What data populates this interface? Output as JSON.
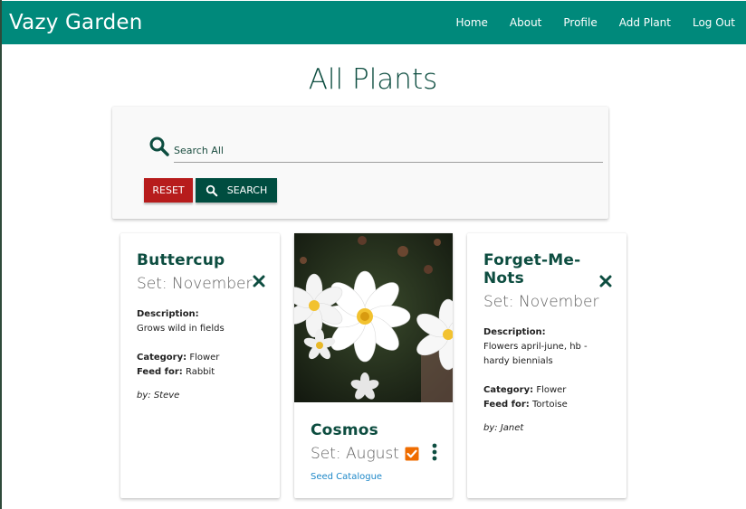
{
  "app": {
    "brand": "Vazy Garden"
  },
  "nav": {
    "items": [
      {
        "label": "Home"
      },
      {
        "label": "About"
      },
      {
        "label": "Profile"
      },
      {
        "label": "Add Plant"
      },
      {
        "label": "Log Out"
      }
    ]
  },
  "page": {
    "title": "All Plants"
  },
  "search": {
    "placeholder": "Search All",
    "value": "",
    "reset_label": "RESET",
    "search_label": "SEARCH"
  },
  "colors": {
    "navbar": "#00897b",
    "title": "#0d4d40",
    "reset": "#b71c1c",
    "search_button": "#004d40",
    "check": "#ef6c00",
    "link": "#1e88c8"
  },
  "cards": [
    {
      "name": "Buttercup",
      "set": "Set: November",
      "description_label": "Description:",
      "description": "Grows wild in fields",
      "category_label": "Category:",
      "category": "Flower",
      "feed_label": "Feed for:",
      "feed": "Rabbit",
      "author": "by: Steve",
      "action_icon": "close-icon"
    },
    {
      "name": "Cosmos",
      "set": "Set: August",
      "status_icon": "checkbox-checked-icon",
      "link": "Seed Catalogue",
      "action_icon": "more-vert-icon"
    },
    {
      "name": "Forget-Me-Nots",
      "set": "Set: November",
      "description_label": "Description:",
      "description": "Flowers april-june, hb - hardy biennials",
      "category_label": "Category:",
      "category": "Flower",
      "feed_label": "Feed for:",
      "feed": "Tortoise",
      "author": "by: Janet",
      "action_icon": "close-icon"
    }
  ]
}
